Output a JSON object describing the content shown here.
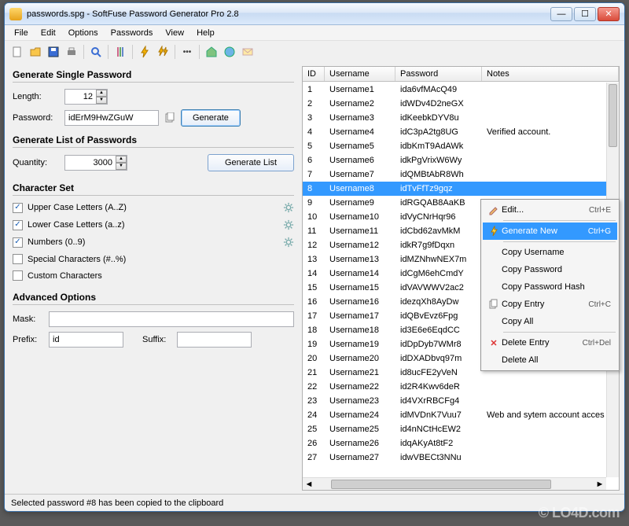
{
  "window": {
    "title": "passwords.spg - SoftFuse Password Generator Pro 2.8"
  },
  "menu": [
    "File",
    "Edit",
    "Options",
    "Passwords",
    "View",
    "Help"
  ],
  "left": {
    "single_title": "Generate Single Password",
    "length_label": "Length:",
    "length_value": "12",
    "password_label": "Password:",
    "password_value": "idErM9HwZGuW",
    "generate_button": "Generate",
    "list_title": "Generate List of Passwords",
    "quantity_label": "Quantity:",
    "quantity_value": "3000",
    "generate_list_button": "Generate List",
    "charset_title": "Character Set",
    "charset": [
      {
        "label": "Upper Case Letters (A..Z)",
        "checked": true
      },
      {
        "label": "Lower Case Letters (a..z)",
        "checked": true
      },
      {
        "label": "Numbers (0..9)",
        "checked": true
      },
      {
        "label": "Special Characters (#..%)",
        "checked": false
      },
      {
        "label": "Custom Characters",
        "checked": false
      }
    ],
    "adv_title": "Advanced Options",
    "mask_label": "Mask:",
    "mask_value": "",
    "prefix_label": "Prefix:",
    "prefix_value": "id",
    "suffix_label": "Suffix:",
    "suffix_value": ""
  },
  "grid": {
    "headers": {
      "id": "ID",
      "user": "Username",
      "pw": "Password",
      "notes": "Notes"
    },
    "selected_index": 7,
    "rows": [
      {
        "id": "1",
        "user": "Username1",
        "pw": "ida6vfMAcQ49",
        "notes": ""
      },
      {
        "id": "2",
        "user": "Username2",
        "pw": "idWDv4D2neGX",
        "notes": ""
      },
      {
        "id": "3",
        "user": "Username3",
        "pw": "idKeebkDYV8u",
        "notes": ""
      },
      {
        "id": "4",
        "user": "Username4",
        "pw": "idC3pA2tg8UG",
        "notes": "Verified account."
      },
      {
        "id": "5",
        "user": "Username5",
        "pw": "idbKmT9AdAWk",
        "notes": ""
      },
      {
        "id": "6",
        "user": "Username6",
        "pw": "idkPgVrixW6Wy",
        "notes": ""
      },
      {
        "id": "7",
        "user": "Username7",
        "pw": "idQMBtAbR8Wh",
        "notes": ""
      },
      {
        "id": "8",
        "user": "Username8",
        "pw": "idTvFfTz9gqz",
        "notes": ""
      },
      {
        "id": "9",
        "user": "Username9",
        "pw": "idRGQAB8AaKB",
        "notes": ""
      },
      {
        "id": "10",
        "user": "Username10",
        "pw": "idVyCNrHqr96",
        "notes": ""
      },
      {
        "id": "11",
        "user": "Username11",
        "pw": "idCbd62avMkM",
        "notes": ""
      },
      {
        "id": "12",
        "user": "Username12",
        "pw": "idkR7g9fDqxn",
        "notes": ""
      },
      {
        "id": "13",
        "user": "Username13",
        "pw": "idMZNhwNEX7m",
        "notes": ""
      },
      {
        "id": "14",
        "user": "Username14",
        "pw": "idCgM6ehCmdY",
        "notes": ""
      },
      {
        "id": "15",
        "user": "Username15",
        "pw": "idVAVWWV2ac2",
        "notes": ""
      },
      {
        "id": "16",
        "user": "Username16",
        "pw": "idezqXh8AyDw",
        "notes": ""
      },
      {
        "id": "17",
        "user": "Username17",
        "pw": "idQBvEvz6Fpg",
        "notes": ""
      },
      {
        "id": "18",
        "user": "Username18",
        "pw": "id3E6e6EqdCC",
        "notes": ""
      },
      {
        "id": "19",
        "user": "Username19",
        "pw": "idDpDyb7WMr8",
        "notes": ""
      },
      {
        "id": "20",
        "user": "Username20",
        "pw": "idDXADbvq97m",
        "notes": ""
      },
      {
        "id": "21",
        "user": "Username21",
        "pw": "id8ucFE2yVeN",
        "notes": ""
      },
      {
        "id": "22",
        "user": "Username22",
        "pw": "id2R4Kwv6deR",
        "notes": ""
      },
      {
        "id": "23",
        "user": "Username23",
        "pw": "id4VXrRBCFg4",
        "notes": ""
      },
      {
        "id": "24",
        "user": "Username24",
        "pw": "idMVDnK7Vuu7",
        "notes": "Web and sytem account acces"
      },
      {
        "id": "25",
        "user": "Username25",
        "pw": "id4nNCtHcEW2",
        "notes": ""
      },
      {
        "id": "26",
        "user": "Username26",
        "pw": "idqAKyAt8tF2",
        "notes": ""
      },
      {
        "id": "27",
        "user": "Username27",
        "pw": "idwVBECt3NNu",
        "notes": ""
      }
    ]
  },
  "context_menu": {
    "edit": "Edit...",
    "edit_sc": "Ctrl+E",
    "gen_new": "Generate New",
    "gen_new_sc": "Ctrl+G",
    "copy_user": "Copy Username",
    "copy_pw": "Copy Password",
    "copy_hash": "Copy Password Hash",
    "copy_entry": "Copy Entry",
    "copy_entry_sc": "Ctrl+C",
    "copy_all": "Copy All",
    "del_entry": "Delete Entry",
    "del_entry_sc": "Ctrl+Del",
    "del_all": "Delete All"
  },
  "statusbar": "Selected password #8 has been copied to the clipboard",
  "watermark": "© LO4D.com"
}
